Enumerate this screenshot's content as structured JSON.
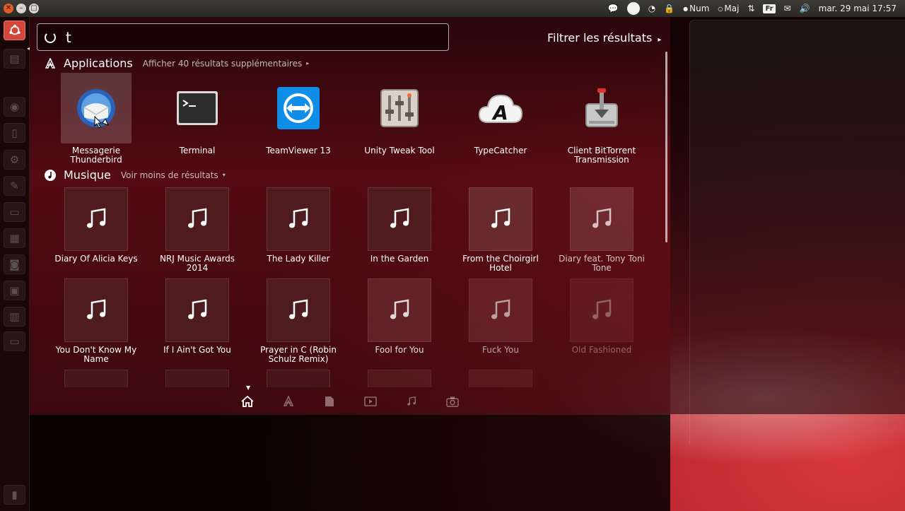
{
  "topbar": {
    "indicators": {
      "num_label": "Num",
      "maj_label": "Maj",
      "keyboard_layout": "Fr",
      "datetime": "mar. 29 mai 17:57"
    }
  },
  "search": {
    "query": "t",
    "filter_label": "Filtrer les résultats"
  },
  "applications": {
    "title": "Applications",
    "more_label": "Afficher 40 résultats supplémentaires",
    "items": [
      {
        "label": "Messagerie Thunderbird",
        "icon": "thunderbird-icon"
      },
      {
        "label": "Terminal",
        "icon": "terminal-icon"
      },
      {
        "label": "TeamViewer 13",
        "icon": "teamviewer-icon"
      },
      {
        "label": "Unity Tweak Tool",
        "icon": "unity-tweak-tool-icon"
      },
      {
        "label": "TypeCatcher",
        "icon": "typecatcher-icon"
      },
      {
        "label": "Client BitTorrent Transmission",
        "icon": "transmission-icon"
      }
    ]
  },
  "music": {
    "title": "Musique",
    "more_label": "Voir moins de résultats",
    "items": [
      {
        "label": "Diary Of Alicia Keys"
      },
      {
        "label": "NRJ Music Awards 2014"
      },
      {
        "label": "The Lady Killer"
      },
      {
        "label": "In the Garden"
      },
      {
        "label": "From the Choirgirl Hotel"
      },
      {
        "label": "Diary feat. Tony Toni Tone"
      },
      {
        "label": "You Don't Know My Name"
      },
      {
        "label": "If I Ain't Got You"
      },
      {
        "label": "Prayer in C (Robin Schulz Remix)"
      },
      {
        "label": "Fool for You"
      },
      {
        "label": "Fuck You"
      },
      {
        "label": "Old Fashioned"
      }
    ]
  },
  "colors": {
    "accent": "#d2473a",
    "wallpaper": "#d8373d"
  }
}
